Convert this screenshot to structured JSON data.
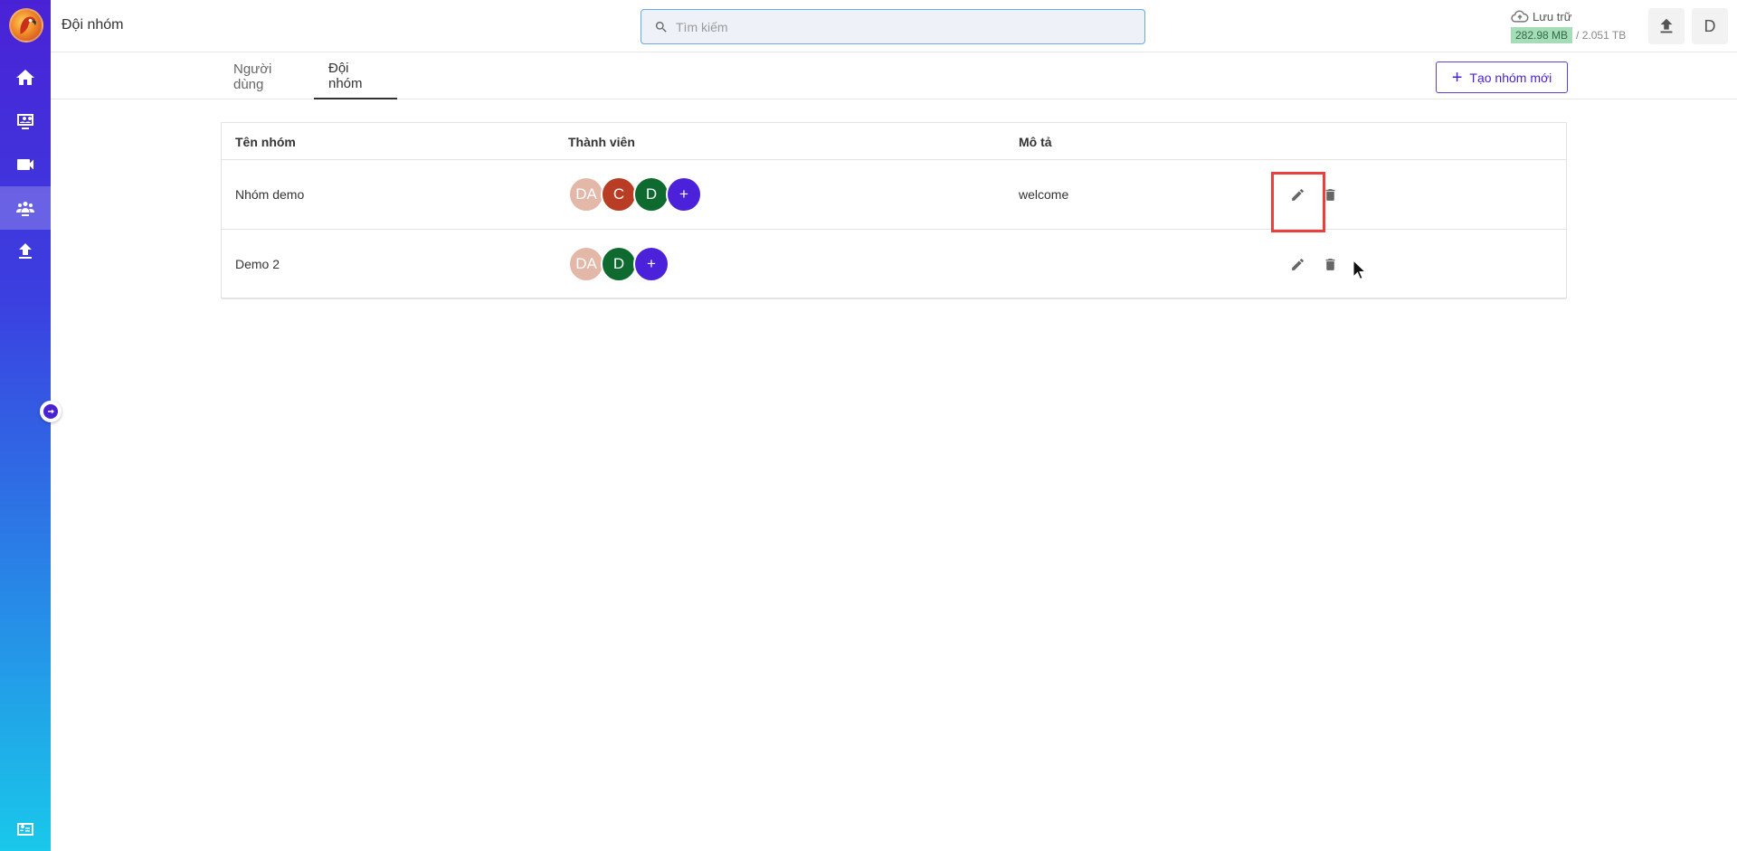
{
  "header": {
    "page_title": "Đội nhóm",
    "search_placeholder": "Tìm kiếm",
    "storage_label": "Lưu trữ",
    "storage_used": "282.98 MB",
    "storage_total": "/ 2.051 TB",
    "user_initial": "D"
  },
  "sidebar": {
    "items": [
      {
        "name": "home-icon"
      },
      {
        "name": "meeting-icon"
      },
      {
        "name": "video-icon"
      },
      {
        "name": "team-icon",
        "active": true
      },
      {
        "name": "upload-icon"
      },
      {
        "name": "id-card-icon"
      }
    ]
  },
  "tabs": [
    {
      "label": "Người dùng",
      "active": false
    },
    {
      "label": "Đội nhóm",
      "active": true
    }
  ],
  "create_button_label": "Tạo nhóm mới",
  "table": {
    "columns": [
      "Tên nhóm",
      "Thành viên",
      "Mô tả"
    ],
    "rows": [
      {
        "name": "Nhóm demo",
        "members": [
          {
            "initials": "DA",
            "color": "#e3b8a8"
          },
          {
            "initials": "C",
            "color": "#b83d24"
          },
          {
            "initials": "D",
            "color": "#0e6a2e"
          },
          {
            "initials": "+",
            "color": "#4b22d9"
          }
        ],
        "description": "welcome"
      },
      {
        "name": "Demo 2",
        "members": [
          {
            "initials": "DA",
            "color": "#e3b8a8"
          },
          {
            "initials": "D",
            "color": "#0e6a2e"
          },
          {
            "initials": "+",
            "color": "#4b22d9"
          }
        ],
        "description": ""
      }
    ]
  },
  "colors": {
    "accent": "#4a22d6",
    "highlight": "#e8403a"
  }
}
